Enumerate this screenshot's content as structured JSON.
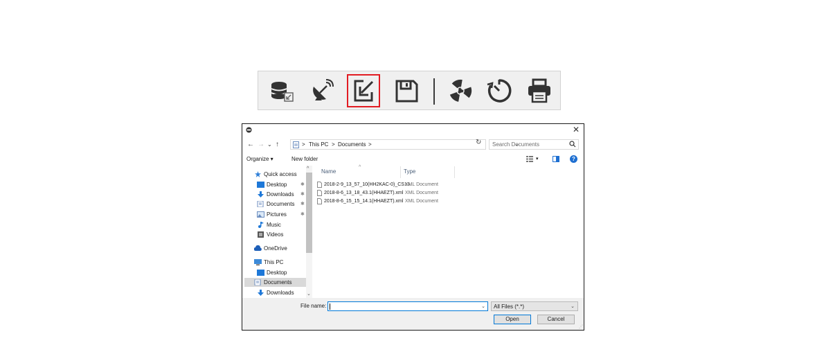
{
  "toolbar": {
    "buttons": [
      {
        "name": "database-import-icon",
        "selected": false
      },
      {
        "name": "satellite-dish-icon",
        "selected": false
      },
      {
        "name": "import-icon",
        "selected": true
      },
      {
        "name": "save-icon",
        "selected": false
      },
      {
        "name": "radiation-icon",
        "selected": false
      },
      {
        "name": "timer-dial-icon",
        "selected": false
      },
      {
        "name": "printer-icon",
        "selected": false
      }
    ],
    "highlight_color": "#e21b22"
  },
  "dialog": {
    "close_glyph": "✕",
    "nav": {
      "back": "←",
      "forward": "→",
      "recent": "⌄",
      "up": "↑",
      "breadcrumb": [
        ">",
        "This PC",
        ">",
        "Documents",
        ">"
      ],
      "dropdown": "⌄",
      "refresh": "↻"
    },
    "search": {
      "placeholder": "Search Documents"
    },
    "commands": {
      "organize": "Organize ▾",
      "new_folder": "New folder",
      "view_dropdown": "▾",
      "help": "?"
    },
    "nav_pane": {
      "quick_access": "Quick access",
      "items": [
        {
          "label": "Desktop",
          "pinned": true,
          "icon": "desktop-folder-icon"
        },
        {
          "label": "Downloads",
          "pinned": true,
          "icon": "downloads-icon"
        },
        {
          "label": "Documents",
          "pinned": true,
          "icon": "documents-icon"
        },
        {
          "label": "Pictures",
          "pinned": true,
          "icon": "pictures-icon"
        },
        {
          "label": "Music",
          "pinned": false,
          "icon": "music-icon"
        },
        {
          "label": "Videos",
          "pinned": false,
          "icon": "videos-icon"
        }
      ],
      "onedrive": "OneDrive",
      "this_pc": "This PC",
      "pc_items": [
        {
          "label": "Desktop",
          "icon": "desktop-folder-icon"
        },
        {
          "label": "Documents",
          "icon": "documents-icon",
          "selected": true
        },
        {
          "label": "Downloads",
          "icon": "downloads-icon"
        }
      ],
      "pin_glyph": "✱"
    },
    "columns": {
      "name": "Name",
      "type": "Type",
      "sort_glyph": "^"
    },
    "files": [
      {
        "name": "2018-2-9_13_57_10(HH2KAC-0)_CS13...",
        "type": "XML Document"
      },
      {
        "name": "2018-8-6_13_18_43.1(HHAEZT).xml",
        "type": "XML Document"
      },
      {
        "name": "2018-8-6_15_15_14.1(HHAEZT).xml",
        "type": "XML Document"
      }
    ],
    "bottom": {
      "file_name_label": "File name:",
      "file_name_value": "",
      "filter": "All Files (*.*)",
      "open": "Open",
      "cancel": "Cancel",
      "dropdown": "⌄"
    }
  }
}
